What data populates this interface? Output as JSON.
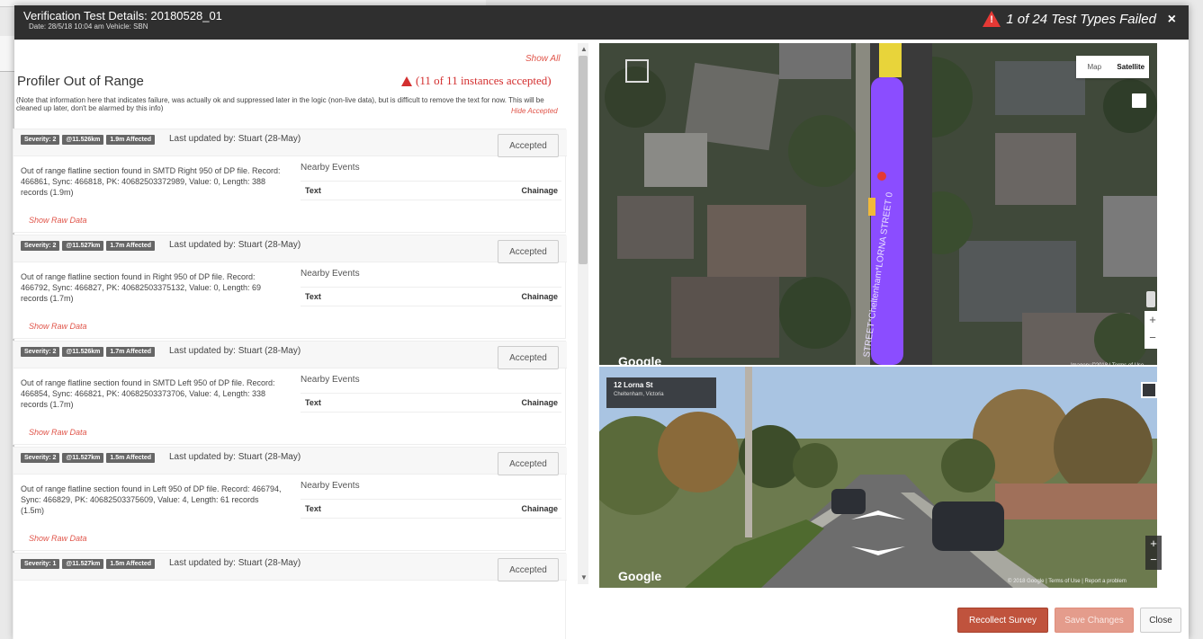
{
  "header": {
    "title": "Verification Test Details: 20180528_01",
    "subtitle": "Date: 28/5/18 10:04 am Vehicle: SBN",
    "fail_text": "1 of 24 Test Types Failed",
    "close_glyph": "×"
  },
  "panel": {
    "show_all": "Show All",
    "section_title": "Profiler Out of Range",
    "instances_text": "(11 of 11 instances accepted)",
    "note": "(Note that information here that indicates failure, was actually ok and suppressed later in the logic (non-live data), but is difficult to remove the text for now. This will be cleaned up later, don't be alarmed by this info)",
    "hide_accepted": "Hide Accepted"
  },
  "cards": [
    {
      "severity": "Severity: 2",
      "position": "@11.526km",
      "affected": "1.9m Affected",
      "updated": "Last updated by: Stuart (28-May)",
      "button": "Accepted",
      "description": "Out of range flatline section found in SMTD Right 950 of DP file. Record: 466861, Sync: 466818, PK: 40682503372989, Value: 0, Length: 388 records (1.9m)",
      "nearby": "Nearby Events",
      "col_text": "Text",
      "col_chainage": "Chainage",
      "raw": "Show Raw Data"
    },
    {
      "severity": "Severity: 2",
      "position": "@11.527km",
      "affected": "1.7m Affected",
      "updated": "Last updated by: Stuart (28-May)",
      "button": "Accepted",
      "description": "Out of range flatline section found in Right 950 of DP file. Record: 466792, Sync: 466827, PK: 40682503375132, Value: 0, Length: 69 records (1.7m)",
      "nearby": "Nearby Events",
      "col_text": "Text",
      "col_chainage": "Chainage",
      "raw": "Show Raw Data"
    },
    {
      "severity": "Severity: 2",
      "position": "@11.526km",
      "affected": "1.7m Affected",
      "updated": "Last updated by: Stuart (28-May)",
      "button": "Accepted",
      "description": "Out of range flatline section found in SMTD Left 950 of DP file. Record: 466854, Sync: 466821, PK: 40682503373706, Value: 4, Length: 338 records (1.7m)",
      "nearby": "Nearby Events",
      "col_text": "Text",
      "col_chainage": "Chainage",
      "raw": "Show Raw Data"
    },
    {
      "severity": "Severity: 2",
      "position": "@11.527km",
      "affected": "1.5m Affected",
      "updated": "Last updated by: Stuart (28-May)",
      "button": "Accepted",
      "description": "Out of range flatline section found in Left 950 of DP file. Record: 466794, Sync: 466829, PK: 40682503375609, Value: 4, Length: 61 records (1.5m)",
      "nearby": "Nearby Events",
      "col_text": "Text",
      "col_chainage": "Chainage",
      "raw": "Show Raw Data"
    },
    {
      "severity": "Severity: 1",
      "position": "@11.527km",
      "affected": "1.5m Affected",
      "updated": "Last updated by: Stuart (28-May)",
      "button": "Accepted",
      "description": "",
      "nearby": "",
      "col_text": "",
      "col_chainage": "",
      "raw": ""
    }
  ],
  "map": {
    "toggle_map": "Map",
    "toggle_satellite": "Satellite",
    "google": "Google",
    "copyright": "Imagery ©2018 | Terms of Use",
    "street_label": "STREET*Cheltenham*LORNA STREET 0",
    "zoom_in": "+",
    "zoom_out": "−"
  },
  "streetview": {
    "address": "12 Lorna St",
    "suburb": "Cheltenham, Victoria",
    "google": "Google",
    "copyright": "© 2018 Google | Terms of Use | Report a problem",
    "zoom_in": "+",
    "zoom_out": "−"
  },
  "footer": {
    "recollect": "Recollect Survey",
    "save": "Save Changes",
    "close": "Close"
  },
  "colors": {
    "header_bg": "#2f2f2f",
    "accent_red": "#d32f2f",
    "link_red": "#e0554a",
    "recollect_bg": "#c0533d",
    "route_purple": "#8b4dff"
  }
}
